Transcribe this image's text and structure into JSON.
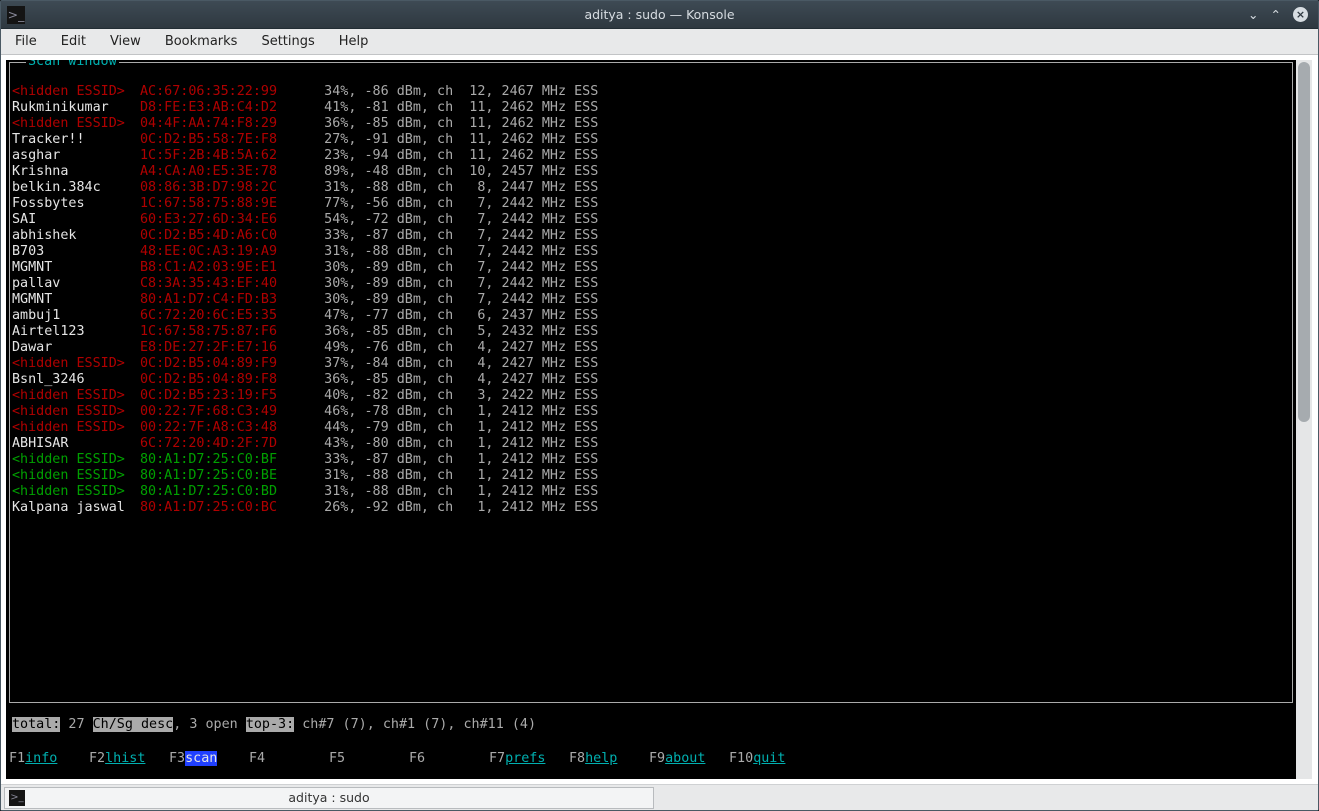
{
  "window": {
    "title": "aditya : sudo — Konsole"
  },
  "menu": {
    "file": "File",
    "edit": "Edit",
    "view": "View",
    "bookmarks": "Bookmarks",
    "settings": "Settings",
    "help": "Help"
  },
  "box_title": "Scan window",
  "networks": [
    {
      "essid": "<hidden ESSID>",
      "essid_style": "red",
      "mac": "AC:67:06:35:22:99",
      "mac_style": "red",
      "signal": "34%",
      "dbm": "-86 dBm",
      "ch": "12",
      "mhz": "2467 MHz",
      "flags": "ESS"
    },
    {
      "essid": "Rukminikumar",
      "essid_style": "white",
      "mac": "D8:FE:E3:AB:C4:D2",
      "mac_style": "red",
      "signal": "41%",
      "dbm": "-81 dBm",
      "ch": "11",
      "mhz": "2462 MHz",
      "flags": "ESS"
    },
    {
      "essid": "<hidden ESSID>",
      "essid_style": "red",
      "mac": "04:4F:AA:74:F8:29",
      "mac_style": "red",
      "signal": "36%",
      "dbm": "-85 dBm",
      "ch": "11",
      "mhz": "2462 MHz",
      "flags": "ESS"
    },
    {
      "essid": "Tracker!!",
      "essid_style": "white",
      "mac": "0C:D2:B5:58:7E:F8",
      "mac_style": "red",
      "signal": "27%",
      "dbm": "-91 dBm",
      "ch": "11",
      "mhz": "2462 MHz",
      "flags": "ESS"
    },
    {
      "essid": "asghar",
      "essid_style": "white",
      "mac": "1C:5F:2B:4B:5A:62",
      "mac_style": "red",
      "signal": "23%",
      "dbm": "-94 dBm",
      "ch": "11",
      "mhz": "2462 MHz",
      "flags": "ESS"
    },
    {
      "essid": "Krishna",
      "essid_style": "white",
      "mac": "A4:CA:A0:E5:3E:78",
      "mac_style": "red",
      "signal": "89%",
      "dbm": "-48 dBm",
      "ch": "10",
      "mhz": "2457 MHz",
      "flags": "ESS"
    },
    {
      "essid": "belkin.384c",
      "essid_style": "white",
      "mac": "08:86:3B:D7:98:2C",
      "mac_style": "red",
      "signal": "31%",
      "dbm": "-88 dBm",
      "ch": "8",
      "mhz": "2447 MHz",
      "flags": "ESS"
    },
    {
      "essid": "Fossbytes",
      "essid_style": "white",
      "mac": "1C:67:58:75:88:9E",
      "mac_style": "red",
      "signal": "77%",
      "dbm": "-56 dBm",
      "ch": "7",
      "mhz": "2442 MHz",
      "flags": "ESS"
    },
    {
      "essid": "SAI",
      "essid_style": "white",
      "mac": "60:E3:27:6D:34:E6",
      "mac_style": "red",
      "signal": "54%",
      "dbm": "-72 dBm",
      "ch": "7",
      "mhz": "2442 MHz",
      "flags": "ESS"
    },
    {
      "essid": "abhishek",
      "essid_style": "white",
      "mac": "0C:D2:B5:4D:A6:C0",
      "mac_style": "red",
      "signal": "33%",
      "dbm": "-87 dBm",
      "ch": "7",
      "mhz": "2442 MHz",
      "flags": "ESS"
    },
    {
      "essid": "B703",
      "essid_style": "white",
      "mac": "48:EE:0C:A3:19:A9",
      "mac_style": "red",
      "signal": "31%",
      "dbm": "-88 dBm",
      "ch": "7",
      "mhz": "2442 MHz",
      "flags": "ESS"
    },
    {
      "essid": "MGMNT",
      "essid_style": "white",
      "mac": "B8:C1:A2:03:9E:E1",
      "mac_style": "red",
      "signal": "30%",
      "dbm": "-89 dBm",
      "ch": "7",
      "mhz": "2442 MHz",
      "flags": "ESS"
    },
    {
      "essid": "pallav",
      "essid_style": "white",
      "mac": "C8:3A:35:43:EF:40",
      "mac_style": "red",
      "signal": "30%",
      "dbm": "-89 dBm",
      "ch": "7",
      "mhz": "2442 MHz",
      "flags": "ESS"
    },
    {
      "essid": "MGMNT",
      "essid_style": "white",
      "mac": "80:A1:D7:C4:FD:B3",
      "mac_style": "red",
      "signal": "30%",
      "dbm": "-89 dBm",
      "ch": "7",
      "mhz": "2442 MHz",
      "flags": "ESS"
    },
    {
      "essid": "ambuj1",
      "essid_style": "white",
      "mac": "6C:72:20:6C:E5:35",
      "mac_style": "red",
      "signal": "47%",
      "dbm": "-77 dBm",
      "ch": "6",
      "mhz": "2437 MHz",
      "flags": "ESS"
    },
    {
      "essid": "Airtel123",
      "essid_style": "white",
      "mac": "1C:67:58:75:87:F6",
      "mac_style": "red",
      "signal": "36%",
      "dbm": "-85 dBm",
      "ch": "5",
      "mhz": "2432 MHz",
      "flags": "ESS"
    },
    {
      "essid": "Dawar",
      "essid_style": "white",
      "mac": "E8:DE:27:2F:E7:16",
      "mac_style": "red",
      "signal": "49%",
      "dbm": "-76 dBm",
      "ch": "4",
      "mhz": "2427 MHz",
      "flags": "ESS"
    },
    {
      "essid": "<hidden ESSID>",
      "essid_style": "red",
      "mac": "0C:D2:B5:04:89:F9",
      "mac_style": "red",
      "signal": "37%",
      "dbm": "-84 dBm",
      "ch": "4",
      "mhz": "2427 MHz",
      "flags": "ESS"
    },
    {
      "essid": "Bsnl_3246",
      "essid_style": "white",
      "mac": "0C:D2:B5:04:89:F8",
      "mac_style": "red",
      "signal": "36%",
      "dbm": "-85 dBm",
      "ch": "4",
      "mhz": "2427 MHz",
      "flags": "ESS"
    },
    {
      "essid": "<hidden ESSID>",
      "essid_style": "red",
      "mac": "0C:D2:B5:23:19:F5",
      "mac_style": "red",
      "signal": "40%",
      "dbm": "-82 dBm",
      "ch": "3",
      "mhz": "2422 MHz",
      "flags": "ESS"
    },
    {
      "essid": "<hidden ESSID>",
      "essid_style": "red",
      "mac": "00:22:7F:68:C3:49",
      "mac_style": "red",
      "signal": "46%",
      "dbm": "-78 dBm",
      "ch": "1",
      "mhz": "2412 MHz",
      "flags": "ESS"
    },
    {
      "essid": "<hidden ESSID>",
      "essid_style": "red",
      "mac": "00:22:7F:A8:C3:48",
      "mac_style": "red",
      "signal": "44%",
      "dbm": "-79 dBm",
      "ch": "1",
      "mhz": "2412 MHz",
      "flags": "ESS"
    },
    {
      "essid": "ABHISAR",
      "essid_style": "white",
      "mac": "6C:72:20:4D:2F:7D",
      "mac_style": "red",
      "signal": "43%",
      "dbm": "-80 dBm",
      "ch": "1",
      "mhz": "2412 MHz",
      "flags": "ESS"
    },
    {
      "essid": "<hidden ESSID>",
      "essid_style": "green",
      "mac": "80:A1:D7:25:C0:BF",
      "mac_style": "green",
      "signal": "33%",
      "dbm": "-87 dBm",
      "ch": "1",
      "mhz": "2412 MHz",
      "flags": "ESS"
    },
    {
      "essid": "<hidden ESSID>",
      "essid_style": "green",
      "mac": "80:A1:D7:25:C0:BE",
      "mac_style": "green",
      "signal": "31%",
      "dbm": "-88 dBm",
      "ch": "1",
      "mhz": "2412 MHz",
      "flags": "ESS"
    },
    {
      "essid": "<hidden ESSID>",
      "essid_style": "green",
      "mac": "80:A1:D7:25:C0:BD",
      "mac_style": "green",
      "signal": "31%",
      "dbm": "-88 dBm",
      "ch": "1",
      "mhz": "2412 MHz",
      "flags": "ESS"
    },
    {
      "essid": "Kalpana jaswal",
      "essid_style": "white",
      "mac": "80:A1:D7:25:C0:BC",
      "mac_style": "red",
      "signal": "26%",
      "dbm": "-92 dBm",
      "ch": "1",
      "mhz": "2412 MHz",
      "flags": "ESS"
    }
  ],
  "summary": {
    "total_label": "total:",
    "total_value": " 27 ",
    "sort_label": "Ch/Sg desc",
    "open_text": ", 3 open ",
    "top3_label": "top-3:",
    "top3_value": " ch#7 (7), ch#1 (7), ch#11 (4)"
  },
  "fkeys": {
    "f1": {
      "key": "F1",
      "label": "info"
    },
    "f2": {
      "key": "F2",
      "label": "lhist"
    },
    "f3": {
      "key": "F3",
      "label": "scan"
    },
    "f4": {
      "key": "F4",
      "label": ""
    },
    "f5": {
      "key": "F5",
      "label": ""
    },
    "f6": {
      "key": "F6",
      "label": ""
    },
    "f7": {
      "key": "F7",
      "label": "prefs"
    },
    "f8": {
      "key": "F8",
      "label": "help"
    },
    "f9": {
      "key": "F9",
      "label": "about"
    },
    "f10": {
      "key": "F10",
      "label": "quit"
    }
  },
  "tab": {
    "title": "aditya : sudo"
  }
}
